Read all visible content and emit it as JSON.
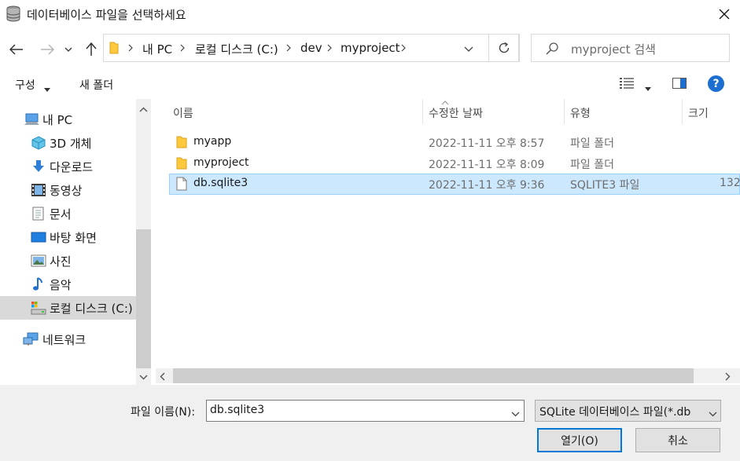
{
  "window": {
    "title": "데이터베이스 파일을 선택하세요",
    "icon": "database-icon",
    "close_icon": "close-icon"
  },
  "navigation": {
    "back_icon": "arrow-left-icon",
    "forward_icon": "arrow-right-icon",
    "recent_icon": "chevron-down-icon",
    "up_icon": "arrow-up-icon",
    "breadcrumbs": [
      "내 PC",
      "로컬 디스크 (C:)",
      "dev",
      "myproject"
    ],
    "refresh_icon": "refresh-icon",
    "search_placeholder": "myproject 검색"
  },
  "toolbar": {
    "organize_label": "구성",
    "new_folder_label": "새 폴더",
    "view_icon": "details-view-icon",
    "preview_pane_icon": "preview-pane-icon",
    "help_label": "?"
  },
  "sidebar": {
    "items": [
      {
        "label": "내 PC",
        "icon": "computer-icon"
      },
      {
        "label": "3D 개체",
        "icon": "cube-icon"
      },
      {
        "label": "다운로드",
        "icon": "download-icon"
      },
      {
        "label": "동영상",
        "icon": "film-icon"
      },
      {
        "label": "문서",
        "icon": "document-icon"
      },
      {
        "label": "바탕 화면",
        "icon": "desktop-icon"
      },
      {
        "label": "사진",
        "icon": "picture-icon"
      },
      {
        "label": "음악",
        "icon": "music-icon"
      },
      {
        "label": "로컬 디스크 (C:)",
        "icon": "drive-icon"
      },
      {
        "label": "네트워크",
        "icon": "network-icon"
      }
    ],
    "selected": "로컬 디스크 (C:)"
  },
  "files": {
    "columns": [
      "이름",
      "수정한 날짜",
      "유형",
      "크기"
    ],
    "rows": [
      {
        "name": "myapp",
        "date": "2022-11-11 오후 8:57",
        "type": "파일 폴더",
        "size": "",
        "icon": "folder-icon"
      },
      {
        "name": "myproject",
        "date": "2022-11-11 오후 8:09",
        "type": "파일 폴더",
        "size": "",
        "icon": "folder-icon"
      },
      {
        "name": "db.sqlite3",
        "date": "2022-11-11 오후 9:36",
        "type": "SQLITE3 파일",
        "size": "132",
        "icon": "file-icon"
      }
    ],
    "selected": "db.sqlite3"
  },
  "footer": {
    "filename_label": "파일 이름(N):",
    "filename_value": "db.sqlite3",
    "filter_value": "SQLite 데이터베이스 파일(*.db",
    "open_label": "열기(O)",
    "cancel_label": "취소"
  },
  "colors": {
    "selection_bg": "#cce8ff",
    "selection_border": "#99d1ff",
    "accent": "#0078d7",
    "folder": "#ffc83d"
  }
}
